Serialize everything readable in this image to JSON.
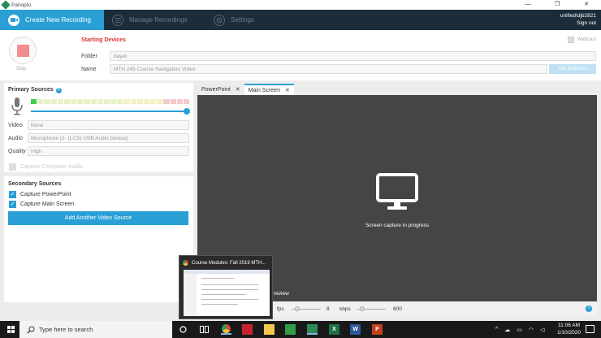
{
  "window": {
    "title": "Panopto",
    "controls": [
      "—",
      "❐",
      "✕"
    ]
  },
  "nav": {
    "tabs": [
      {
        "label": "Create New Recording",
        "active": true
      },
      {
        "label": "Manage Recordings",
        "active": false
      },
      {
        "label": "Settings",
        "active": false
      }
    ],
    "user": "unified\\djb2821",
    "signout": "Sign out"
  },
  "recording": {
    "stop_label": "Stop",
    "starting_devices": "Starting Devices",
    "folder_label": "Folder",
    "folder_value": "bayet",
    "name_label": "Name",
    "name_value": "MTH 245 Course Navigation Video",
    "webcast_label": "Webcast",
    "stats_button": "Get Statistics"
  },
  "primary": {
    "title": "Primary Sources",
    "help": "?",
    "video_label": "Video",
    "video_value": "None",
    "audio_label": "Audio",
    "audio_value": "Microphone (2- (LCS) USB Audio Device)",
    "quality_label": "Quality",
    "quality_value": "High",
    "computer_audio": "Capture Computer Audio",
    "meter_level": 0.04,
    "volume_level": 1.0
  },
  "secondary": {
    "title": "Secondary Sources",
    "capture_ppt": "Capture PowerPoint",
    "capture_screen": "Capture Main Screen",
    "add_button": "Add Another Video Source"
  },
  "preview": {
    "tabs": [
      {
        "label": "PowerPoint",
        "active": false,
        "close": "✕"
      },
      {
        "label": "Main Screen",
        "active": true,
        "close": "✕"
      }
    ],
    "status_text": "Screen capture in progress",
    "preview_label": "review",
    "fps_label": "fps",
    "fps_value": "8",
    "kbps_label": "kbps",
    "kbps_value": "600",
    "help": "?"
  },
  "thumbnail": {
    "title": "Course Modules: Fall 2019 MTH..."
  },
  "taskbar": {
    "search_placeholder": "Type here to search",
    "time": "11:06 AM",
    "date": "1/10/2020",
    "tray_chevron": "^"
  },
  "colors": {
    "accent": "#2a9fd6",
    "nav_bg": "#1c2d3a",
    "stop_red": "#f28d8d",
    "preview_bg": "#454545"
  }
}
